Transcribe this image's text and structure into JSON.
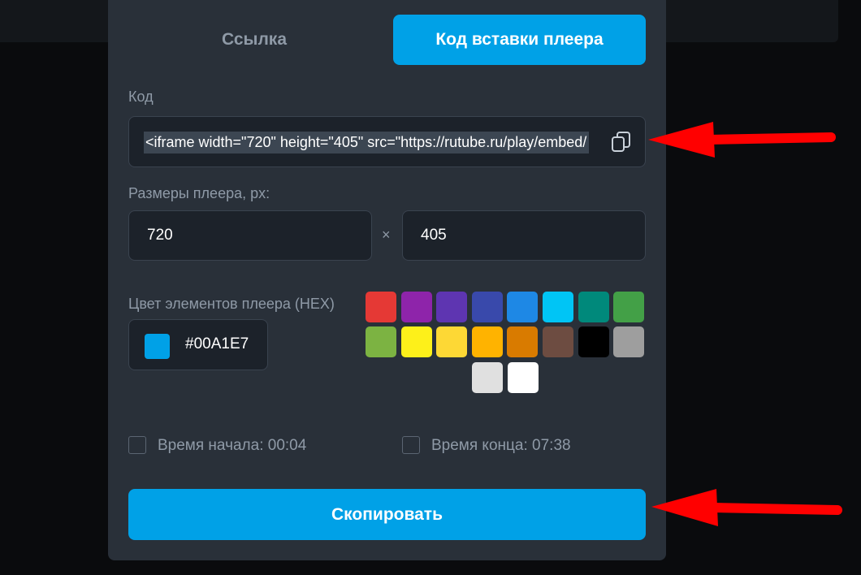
{
  "tabs": [
    {
      "label": "Ссылка",
      "active": false
    },
    {
      "label": "Код вставки плеера",
      "active": true
    }
  ],
  "code": {
    "label": "Код",
    "value": "<iframe width=\"720\" height=\"405\" src=\"https://rutube.ru/play/embed/",
    "copy_icon": "copy-icon"
  },
  "player_size": {
    "label": "Размеры плеера, px:",
    "width": "720",
    "separator": "×",
    "height": "405"
  },
  "color": {
    "label": "Цвет элементов плеера (HEX)",
    "value": "#00A1E7",
    "swatches": [
      "#e53935",
      "#8e24aa",
      "#5e35b1",
      "#3949ab",
      "#1e88e5",
      "#00c5f5",
      "#00897b",
      "#43a047",
      "#7cb342",
      "#fdf01a",
      "#fdd835",
      "#ffb300",
      "#d97b00",
      "#6d4c41",
      "#000000",
      "#9e9e9e",
      "#e0e0e0",
      "#ffffff"
    ]
  },
  "time": {
    "start_label": "Время начала: 00:04",
    "end_label": "Время конца: 07:38",
    "start_checked": false,
    "end_checked": false
  },
  "copy_button": {
    "label": "Скопировать"
  },
  "annotation": {
    "arrow_color": "#ff0000"
  }
}
